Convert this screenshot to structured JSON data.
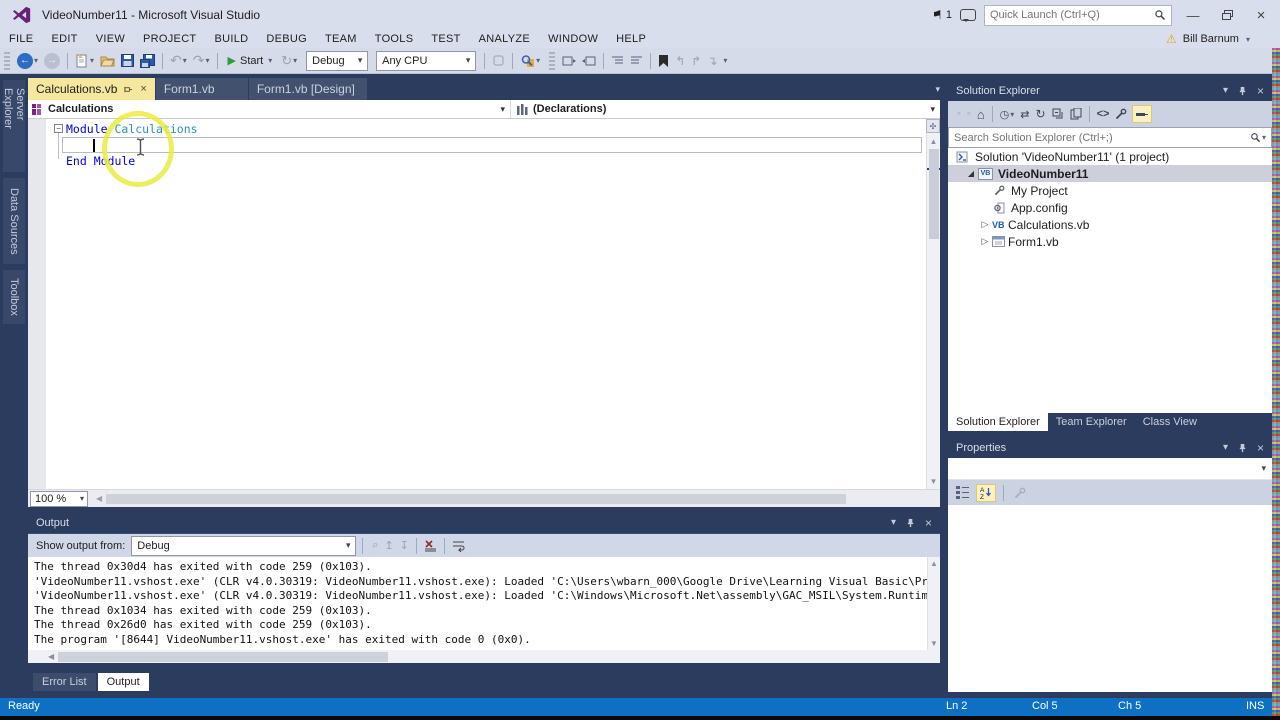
{
  "colors": {
    "accent": "#0D70C2",
    "active_tab": "#F5E79E",
    "keyword_blue": "#0000D8",
    "type_teal": "#2B91AF",
    "annotation_yellow": "#E9EB3E"
  },
  "window": {
    "title": "VideoNumber11 - Microsoft Visual Studio",
    "notification_count": "1",
    "quick_launch_placeholder": "Quick Launch (Ctrl+Q)",
    "user_name": "Bill Barnum"
  },
  "menu": {
    "items": [
      "FILE",
      "EDIT",
      "VIEW",
      "PROJECT",
      "BUILD",
      "DEBUG",
      "TEAM",
      "TOOLS",
      "TEST",
      "ANALYZE",
      "WINDOW",
      "HELP"
    ]
  },
  "toolbar": {
    "start_label": "Start",
    "configuration": "Debug",
    "platform": "Any CPU"
  },
  "left_rail": {
    "tabs": [
      "Server Explorer",
      "Data Sources",
      "Toolbox"
    ]
  },
  "editor": {
    "tabs": [
      {
        "label": "Calculations.vb"
      },
      {
        "label": "Form1.vb"
      },
      {
        "label": "Form1.vb [Design]"
      }
    ],
    "nav": {
      "scope": "Calculations",
      "member": "(Declarations)"
    },
    "code": {
      "line1_keyword": "Module",
      "line1_type": "Calculations",
      "line3_keyword": "End Module"
    },
    "zoom_level": "100 %"
  },
  "solution_explorer": {
    "title": "Solution Explorer",
    "search_placeholder": "Search Solution Explorer (Ctrl+;)",
    "tree": {
      "solution": "Solution 'VideoNumber11' (1 project)",
      "project": "VideoNumber11",
      "items": [
        "My Project",
        "App.config",
        "Calculations.vb",
        "Form1.vb"
      ]
    },
    "tabs": [
      "Solution Explorer",
      "Team Explorer",
      "Class View"
    ]
  },
  "properties": {
    "title": "Properties"
  },
  "output": {
    "title": "Output",
    "show_output_from_label": "Show output from:",
    "source": "Debug",
    "lines": [
      "The thread 0x30d4 has exited with code 259 (0x103).",
      "'VideoNumber11.vshost.exe' (CLR v4.0.30319: VideoNumber11.vshost.exe): Loaded 'C:\\Users\\wbarn_000\\Google Drive\\Learning Visual Basic\\Pr",
      "'VideoNumber11.vshost.exe' (CLR v4.0.30319: VideoNumber11.vshost.exe): Loaded 'C:\\Windows\\Microsoft.Net\\assembly\\GAC_MSIL\\System.Runtim",
      "The thread 0x1034 has exited with code 259 (0x103).",
      "The thread 0x26d0 has exited with code 259 (0x103).",
      "The program '[8644] VideoNumber11.vshost.exe' has exited with code 0 (0x0)."
    ]
  },
  "bottom_tabs": {
    "error_list": "Error List",
    "output": "Output"
  },
  "status_bar": {
    "state": "Ready",
    "line": "Ln 2",
    "column": "Col 5",
    "character": "Ch 5",
    "mode": "INS"
  }
}
